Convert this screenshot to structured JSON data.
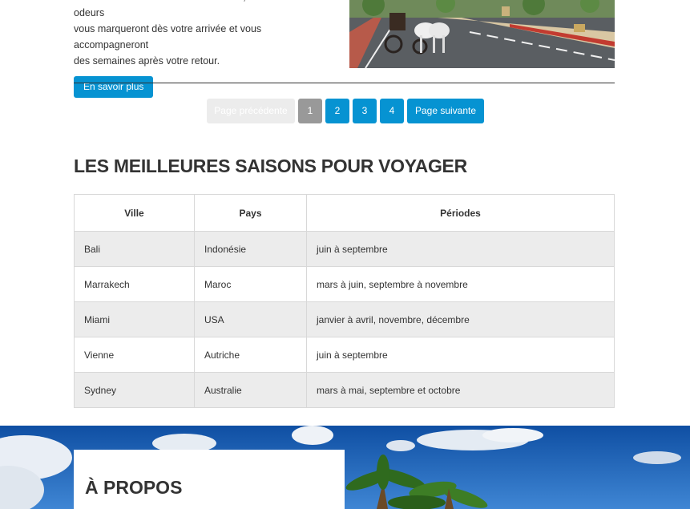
{
  "article": {
    "lines": [
      "stimulera tous vos sens : ses couleurs, ses saveurs et ses odeurs",
      "vous marqueront dès votre arrivée et vous accompagneront",
      "des semaines après votre retour."
    ],
    "button_label": "En savoir plus"
  },
  "pagination": {
    "prev_label": "Page précédente",
    "pages": [
      "1",
      "2",
      "3",
      "4"
    ],
    "current_page": "1",
    "next_label": "Page suivante"
  },
  "seasons": {
    "title": "LES MEILLEURES SAISONS POUR VOYAGER",
    "headers": [
      "Ville",
      "Pays",
      "Périodes"
    ],
    "rows": [
      [
        "Bali",
        "Indonésie",
        "juin à septembre"
      ],
      [
        "Marrakech",
        "Maroc",
        "mars à juin, septembre à novembre"
      ],
      [
        "Miami",
        "USA",
        "janvier à avril, novembre, décembre"
      ],
      [
        "Vienne",
        "Autriche",
        "juin à septembre"
      ],
      [
        "Sydney",
        "Australie",
        "mars à mai, septembre et octobre"
      ]
    ]
  },
  "about": {
    "title": "À PROPOS"
  },
  "colors": {
    "accent": "#0693d2",
    "active_page": "#999999",
    "row_alt": "#ececec",
    "sky": "#1f5fb0"
  }
}
